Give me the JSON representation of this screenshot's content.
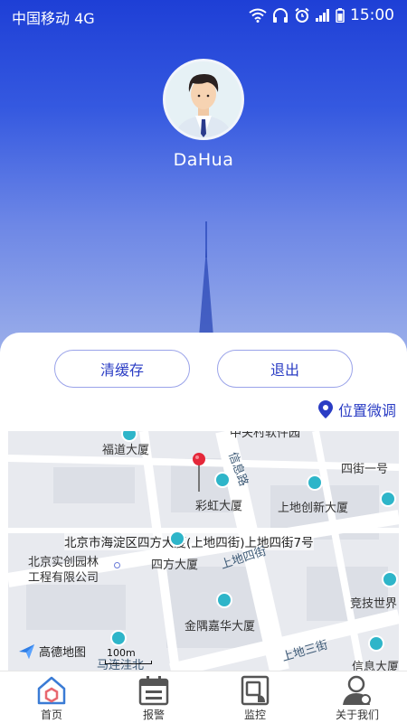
{
  "status": {
    "carrier": "中国移动 4G",
    "time": "15:00"
  },
  "profile": {
    "username": "DaHua"
  },
  "actions": {
    "clear_cache": "清缓存",
    "logout": "退出",
    "location_adjust": "位置微调"
  },
  "map": {
    "address": "北京市海淀区四方大厦(上地四街)上地四街7号",
    "labels": {
      "fudao": "福道大厦",
      "caihong": "彩虹大厦",
      "sifang": "四方大厦",
      "shangdi_chuangxin": "上地创新大厦",
      "shiji_line1": "北京实创园林",
      "shiji_line2": "工程有限公司",
      "jinyu": "金隅嘉华大厦",
      "jingji": "竞技世界",
      "xinxi_dasha": "信息大厦",
      "road_xinxi": "信息路",
      "road_sijie": "上地四街",
      "road_sanjie": "上地三街",
      "road_sijieyi": "四街一号",
      "road_malian": "马连洼北",
      "top_clip": "中关村软件园"
    },
    "logo": "高德地图",
    "scale": "100m"
  },
  "tabs": [
    {
      "label": "首页",
      "icon": "home-icon",
      "active": true
    },
    {
      "label": "报警",
      "icon": "calendar-icon",
      "active": false
    },
    {
      "label": "监控",
      "icon": "monitor-icon",
      "active": false
    },
    {
      "label": "关于我们",
      "icon": "person-icon",
      "active": false
    }
  ],
  "colors": {
    "accent": "#2a3cc4",
    "hero_top": "#1e3fd6",
    "poi": "#2eb5c9",
    "pin": "#e5283a"
  }
}
